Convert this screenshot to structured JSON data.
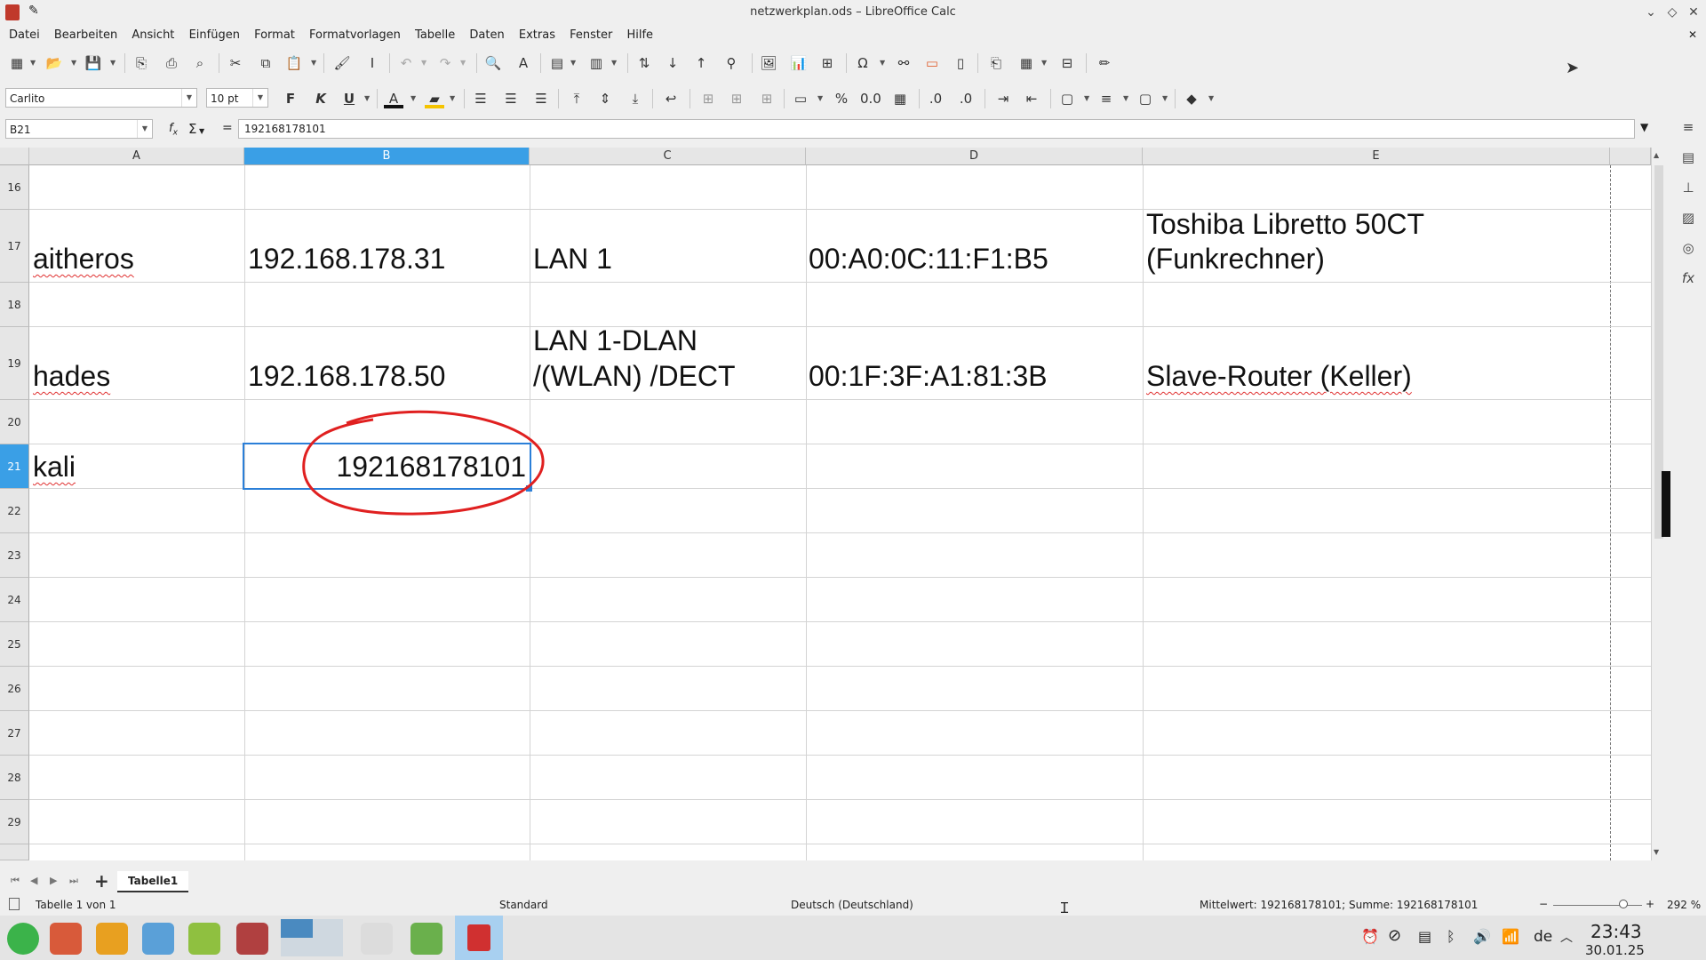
{
  "window": {
    "title": "netzwerkplan.ods – LibreOffice Calc"
  },
  "menu": [
    "Datei",
    "Bearbeiten",
    "Ansicht",
    "Einfügen",
    "Format",
    "Formatvorlagen",
    "Tabelle",
    "Daten",
    "Extras",
    "Fenster",
    "Hilfe"
  ],
  "font": {
    "name": "Carlito",
    "size": "10 pt"
  },
  "formula": {
    "cell_ref": "B21",
    "value": "192168178101",
    "fx": "f",
    "sum": "Σ",
    "eq": "="
  },
  "columns": [
    "A",
    "B",
    "C",
    "D",
    "E"
  ],
  "selected_column": "B",
  "rows": [
    {
      "num": "16",
      "cells": [
        "",
        "",
        "",
        "",
        ""
      ]
    },
    {
      "num": "17",
      "cells": [
        "aitheros",
        "192.168.178.31",
        "LAN 1",
        "00:A0:0C:11:F1:B5",
        "Toshiba Libretto 50CT (Funkrechner)"
      ]
    },
    {
      "num": "18",
      "cells": [
        "",
        "",
        "",
        "",
        ""
      ]
    },
    {
      "num": "19",
      "cells": [
        "hades",
        "192.168.178.50",
        "LAN 1-DLAN /(WLAN) /DECT",
        "00:1F:3F:A1:81:3B",
        "Slave-Router (Keller)"
      ]
    },
    {
      "num": "20",
      "cells": [
        "",
        "",
        "",
        "",
        ""
      ]
    },
    {
      "num": "21",
      "cells": [
        "kali",
        "192168178101",
        "",
        "",
        ""
      ]
    },
    {
      "num": "22",
      "cells": []
    },
    {
      "num": "23",
      "cells": []
    },
    {
      "num": "24",
      "cells": []
    },
    {
      "num": "25",
      "cells": []
    },
    {
      "num": "26",
      "cells": []
    },
    {
      "num": "27",
      "cells": []
    },
    {
      "num": "28",
      "cells": []
    },
    {
      "num": "29",
      "cells": []
    }
  ],
  "cell_text": {
    "a17": "aitheros",
    "b17": "192.168.178.31",
    "c17": "LAN 1",
    "d17": "00:A0:0C:11:F1:B5",
    "e17_l1": "Toshiba Libretto 50CT",
    "e17_l2": "(Funkrechner)",
    "a19": "hades",
    "b19": "192.168.178.50",
    "c19_l1": "LAN 1-DLAN",
    "c19_l2": "/(WLAN) /DECT",
    "d19": "00:1F:3F:A1:81:3B",
    "e19": "Slave-Router (Keller)",
    "a21": "kali",
    "b21": "192168178101"
  },
  "sheet_tab": "Tabelle1",
  "status": {
    "sheet_info": "Tabelle 1 von 1",
    "style": "Standard",
    "language": "Deutsch (Deutschland)",
    "summary": "Mittelwert: 192168178101; Summe: 192168178101",
    "zoom": "292 %"
  },
  "taskbar": {
    "lang": "de",
    "time": "23:43",
    "date": "30.01.25"
  },
  "colors": {
    "selected_header": "#3a9fe6",
    "annotation": "#e02020",
    "spell_error": "#e03030"
  }
}
